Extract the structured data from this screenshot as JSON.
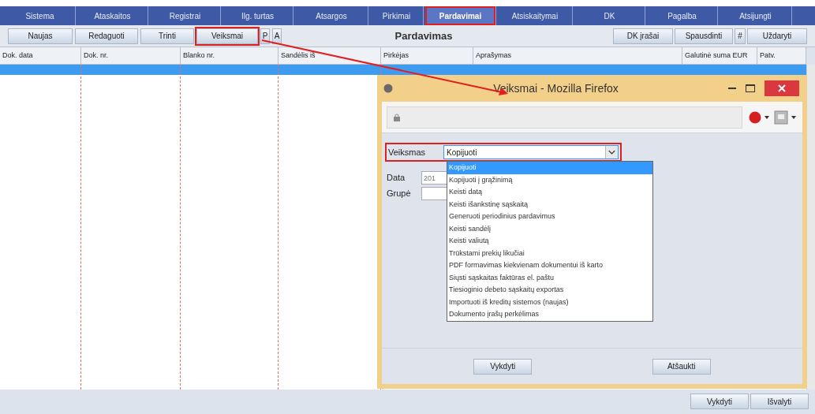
{
  "menu": [
    {
      "label": "Sistema",
      "selected": false,
      "highlighted": false
    },
    {
      "label": "Ataskaitos",
      "selected": false,
      "highlighted": false
    },
    {
      "label": "Registrai",
      "selected": false,
      "highlighted": false
    },
    {
      "label": "Ilg. turtas",
      "selected": false,
      "highlighted": false
    },
    {
      "label": "Atsargos",
      "selected": false,
      "highlighted": false
    },
    {
      "label": "Pirkimai",
      "selected": false,
      "highlighted": false
    },
    {
      "label": "Pardavimai",
      "selected": true,
      "highlighted": true
    },
    {
      "label": "Atsiskaitymai",
      "selected": false,
      "highlighted": false
    },
    {
      "label": "DK",
      "selected": false,
      "highlighted": false
    },
    {
      "label": "Pagalba",
      "selected": false,
      "highlighted": false
    },
    {
      "label": "Atsijungti",
      "selected": false,
      "highlighted": false
    }
  ],
  "toolbar": {
    "left_buttons": [
      {
        "label": "Naujas",
        "highlighted": false
      },
      {
        "label": "Redaguoti",
        "highlighted": false
      },
      {
        "label": "Trinti",
        "highlighted": false
      },
      {
        "label": "Veiksmai",
        "highlighted": true
      },
      {
        "label": "P",
        "highlighted": false
      },
      {
        "label": "A",
        "highlighted": false
      }
    ],
    "title": "Pardavimas",
    "right_buttons": [
      "DK įrašai",
      "Spausdinti",
      "#",
      "Uždaryti"
    ]
  },
  "table": {
    "columns": [
      "Dok. data",
      "Dok. nr.",
      "Blanko nr.",
      "Sandėlis iš",
      "Pirkėjas",
      "Aprašymas",
      "Galutinė suma EUR",
      "Patv."
    ],
    "rows": [
      {
        "selected": true
      }
    ]
  },
  "dialog": {
    "title": "Veiksmai - Mozilla Firefox",
    "action": {
      "label": "Veiksmas",
      "value": "Kopijuoti",
      "highlighted": true,
      "expanded": true,
      "options": [
        {
          "label": "Kopijuoti",
          "selected": true
        },
        {
          "label": "Kopijuoti į grąžinimą",
          "selected": false
        },
        {
          "label": "Keisti datą",
          "selected": false
        },
        {
          "label": "Keisti išankstinę sąskaitą",
          "selected": false
        },
        {
          "label": "Generuoti periodinius pardavimus",
          "selected": false
        },
        {
          "label": "Keisti sandėlį",
          "selected": false
        },
        {
          "label": "Keisti valiutą",
          "selected": false
        },
        {
          "label": "Trūkstami prekių likučiai",
          "selected": false
        },
        {
          "label": "PDF formavimas kiekvienam dokumentui iš karto",
          "selected": false
        },
        {
          "label": "Siųsti sąskaitas faktūras el. paštu",
          "selected": false
        },
        {
          "label": "Tiesioginio debeto sąskaitų exportas",
          "selected": false
        },
        {
          "label": "Importuoti iš kreditų sistemos (naujas)",
          "selected": false
        },
        {
          "label": "Dokumento įrašų perkėlimas",
          "selected": false
        }
      ]
    },
    "fields": [
      {
        "label": "Data",
        "value": "201"
      },
      {
        "label": "Grupė"
      }
    ],
    "buttons": [
      "Vykdyti",
      "Atšaukti"
    ]
  },
  "bottom_buttons": [
    "Vykdyti",
    "Išvalyti"
  ]
}
